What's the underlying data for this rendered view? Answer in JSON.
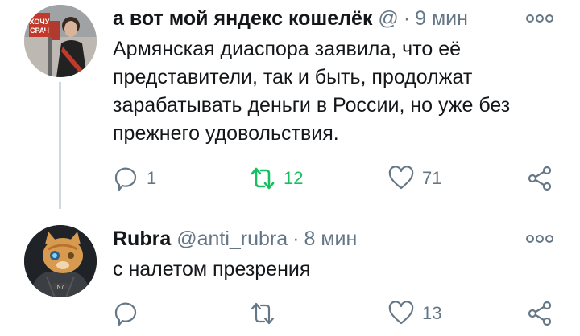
{
  "tweets": [
    {
      "display_name": "а вот мой яндекс кошелёк",
      "handle": "@",
      "separator": "·",
      "time": "9 мин",
      "text": "Армянская диаспора заявила, что её представители, так и быть, продолжат зарабатывать деньги в России, но уже без прежнего удовольствия.",
      "replies": "1",
      "retweets": "12",
      "likes": "71",
      "retweeted": true,
      "avatar_caption": "ХОЧУ СРАЧ"
    },
    {
      "display_name": "Rubra",
      "handle": "@anti_rubra",
      "separator": "·",
      "time": "8 мин",
      "text": "с налетом презрения",
      "replies": "",
      "retweets": "",
      "likes": "13",
      "retweeted": false,
      "avatar_badge": "N7"
    }
  ],
  "colors": {
    "text": "#14171a",
    "secondary": "#657786",
    "retweet_active": "#17bf63",
    "icon_gray": "#657786",
    "divider": "#e6ecf0"
  },
  "icons": {
    "reply": "reply-icon",
    "retweet": "retweet-icon",
    "like": "heart-icon",
    "share": "share-icon",
    "more": "more-icon"
  }
}
